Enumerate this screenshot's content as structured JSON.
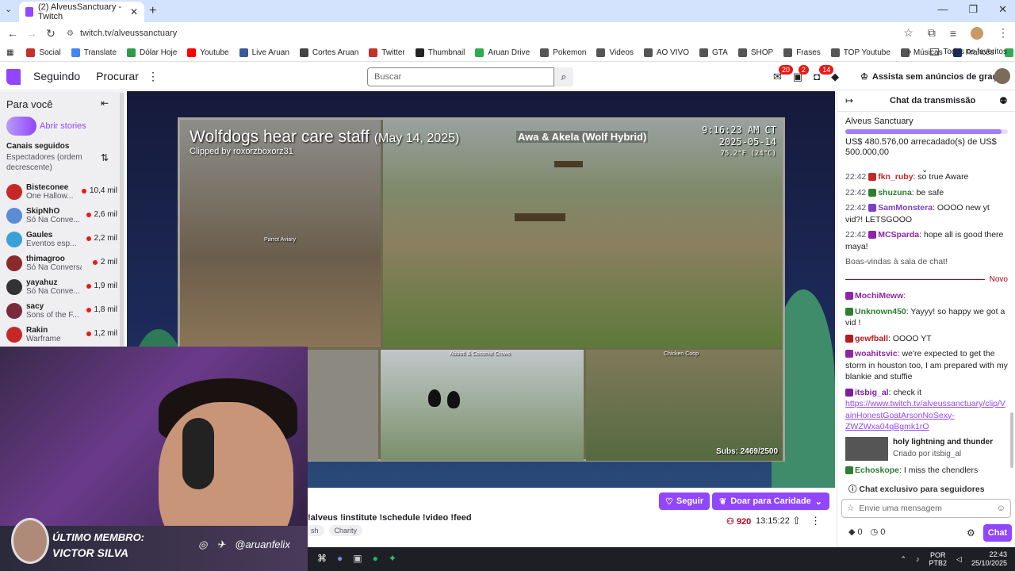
{
  "browser": {
    "tab_title": "(2) AlveusSanctuary - Twitch",
    "url": "twitch.tv/alveussanctuary",
    "bookmarks": [
      {
        "label": "Social",
        "color": "#c4302b"
      },
      {
        "label": "Translate",
        "color": "#4285f4"
      },
      {
        "label": "Dólar Hoje",
        "color": "#2e9c4a"
      },
      {
        "label": "Youtube",
        "color": "#ff0000"
      },
      {
        "label": "Live Aruan",
        "color": "#3b5998"
      },
      {
        "label": "Cortes Aruan",
        "color": "#444444"
      },
      {
        "label": "Twitter",
        "color": "#c4302b"
      },
      {
        "label": "Thumbnail",
        "color": "#222222"
      },
      {
        "label": "Aruan Drive",
        "color": "#34a853"
      },
      {
        "label": "Pokemon",
        "color": "#555555"
      },
      {
        "label": "Videos",
        "color": "#555555"
      },
      {
        "label": "AO VIVO",
        "color": "#555555"
      },
      {
        "label": "GTA",
        "color": "#555555"
      },
      {
        "label": "SHOP",
        "color": "#555555"
      },
      {
        "label": "Frases",
        "color": "#555555"
      },
      {
        "label": "TOP Youtube",
        "color": "#555555"
      },
      {
        "label": "Músicas",
        "color": "#555555"
      },
      {
        "label": "Francês",
        "color": "#1a2a6c"
      },
      {
        "label": "Agenda",
        "color": "#34a853"
      }
    ],
    "all_favorites": "Todos os favoritos"
  },
  "twitch": {
    "nav": [
      "Seguindo",
      "Procurar"
    ],
    "search_placeholder": "Buscar",
    "badges": {
      "inbox": "20",
      "whispers": "2",
      "notifications": "14"
    },
    "prime": "Assista sem anúncios de graça"
  },
  "sidebar": {
    "title": "Para você",
    "stories": "Abrir stories",
    "section": "Canais seguidos",
    "sort": "Espectadores (ordem decrescente)",
    "channels": [
      {
        "name": "Bisteconee",
        "game": "One Hallow...",
        "viewers": "10,4 mil",
        "color": "#c62828"
      },
      {
        "name": "SkipNhO",
        "game": "Só Na Conve...",
        "viewers": "2,6 mil",
        "color": "#5a8bd6"
      },
      {
        "name": "Gaules",
        "game": "Eventos esp...",
        "viewers": "2,2 mil",
        "color": "#3aa0d8"
      },
      {
        "name": "thimagroo",
        "game": "Só Na Conversa",
        "viewers": "2 mil",
        "color": "#8a2a2a"
      },
      {
        "name": "yayahuz",
        "game": "Só Na Conve...",
        "viewers": "1,9 mil",
        "color": "#333333"
      },
      {
        "name": "sacy",
        "game": "Sons of the F...",
        "viewers": "1,8 mil",
        "color": "#7a2a3a"
      },
      {
        "name": "Rakin",
        "game": "Warframe",
        "viewers": "1,2 mil",
        "color": "#c62828"
      }
    ]
  },
  "video": {
    "clip_title": "Wolfdogs hear care staff",
    "clip_date": "(May 14, 2025)",
    "clipped_by": "Clipped by roxorzboxorz31",
    "cam_name": "Awa & Akela (Wolf Hybrid)",
    "clock_time": "9:16:23 AM CT",
    "clock_date": "2025-05-14",
    "clock_temp": "75.2°F (24°C)",
    "label_parrot": "Parrot Aviary",
    "label_crows": "Abbott & Coconut Crows",
    "label_chicken": "Chicken Coop",
    "subs": "Subs: 2469/2500"
  },
  "stream": {
    "follow": "Seguir",
    "donate": "Doar para Caridade",
    "commands": "!alveus !institute !schedule !video !feed",
    "tags": [
      "sh",
      "Charity"
    ],
    "viewers": "920",
    "uptime": "13:15:22"
  },
  "webcam": {
    "label_member": "ÚLTIMO MEMBRO:",
    "member_name": "VICTOR SILVA",
    "handle": "@aruanfelix"
  },
  "chat": {
    "title": "Chat da transmissão",
    "goal_name": "Alveus Sanctuary",
    "goal_progress": 0.96,
    "goal_amount": "US$ 480.576,00 arrecadado(s) de US$ 500.000,00",
    "messages": [
      {
        "time": "22:42",
        "user": "fkn_ruby",
        "color": "#c62828",
        "text": "so true Aware"
      },
      {
        "time": "22:42",
        "user": "shuzuna",
        "color": "#2e7d32",
        "text": "be safe"
      },
      {
        "time": "22:42",
        "user": "SamMonstera",
        "color": "#7b3fc9",
        "text": "OOOO new yt vid?! LETSGOOO"
      },
      {
        "time": "22:42",
        "user": "MCSparda",
        "color": "#8e24aa",
        "text": "hope all is good there maya!"
      }
    ],
    "welcome": "Boas-vindas à sala de chat!",
    "novo": "Novo",
    "new_messages": [
      {
        "user": "MochiMeww",
        "color": "#8e24aa",
        "text": ""
      },
      {
        "user": "Unknown450",
        "color": "#2e7d32",
        "text": "Yayyy! so happy we got a vid !"
      },
      {
        "user": "gewfball",
        "color": "#b71c1c",
        "text": "OOOO YT"
      },
      {
        "user": "woahitsvic",
        "color": "#8e24aa",
        "text": "we're expected to get the storm in houston too, I am prepared with my blankie and stuffie"
      },
      {
        "user": "itsbig_al",
        "color": "#7b1fa2",
        "text": "check it"
      }
    ],
    "link": "https://www.twitch.tv/alveussanctuary/clip/VainHonestGoatArsonNoSexy-ZWZWxa04qBgmk1rO",
    "clip_card_title": "holy lightning and thunder",
    "clip_card_by": "Criado por itsbig_al",
    "last_msg": {
      "user": "Echoskope",
      "color": "#2e7d32",
      "text": "I miss the chendlers"
    },
    "notice": "Chat exclusivo para seguidores",
    "input_placeholder": "Envie uma mensagem",
    "points_a": "0",
    "points_b": "0",
    "send": "Chat"
  },
  "taskbar": {
    "lang": "POR",
    "kb": "PTB2",
    "time": "22:43",
    "date": "25/10/2025"
  }
}
